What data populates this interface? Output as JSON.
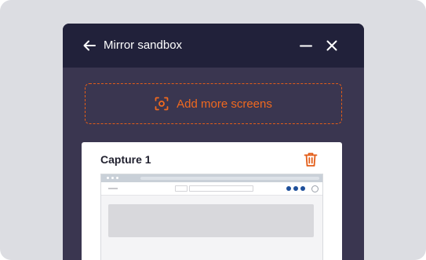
{
  "window": {
    "title": "Mirror sandbox",
    "icons": {
      "back": "arrow-left-icon",
      "minimize": "minus-icon",
      "close": "x-icon"
    }
  },
  "add_screens": {
    "label": "Add more screens",
    "icon": "screen-capture-icon"
  },
  "captures": [
    {
      "title": "Capture 1",
      "delete_icon": "trash-icon"
    }
  ],
  "colors": {
    "accent": "#f0691f",
    "titlebar": "#21213a",
    "panel": "#3a3650",
    "preview_accent": "#1e4f9a"
  }
}
